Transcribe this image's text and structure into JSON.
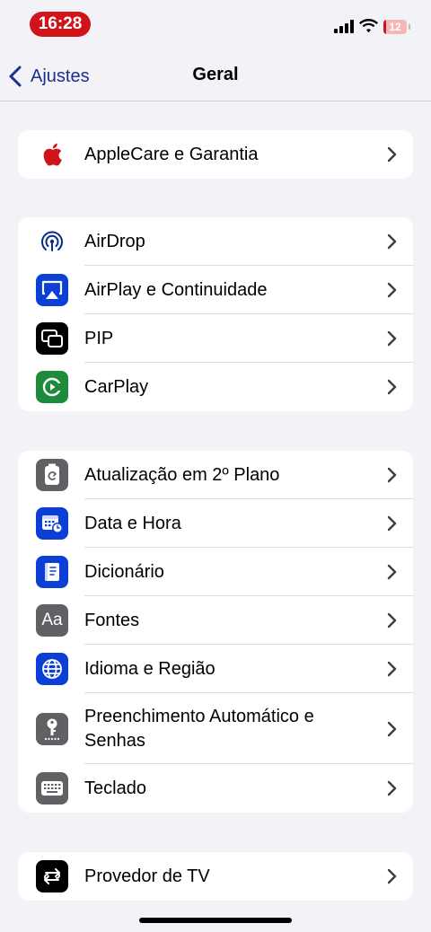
{
  "status_bar": {
    "time": "16:28",
    "battery_level": "12",
    "battery_fraction": 0.12,
    "time_pill_color": "#d0141b"
  },
  "nav": {
    "back_label": "Ajustes",
    "title": "Geral",
    "accent_color": "#1c2f8a"
  },
  "groups": [
    {
      "items": [
        {
          "label": "AppleCare e Garantia",
          "icon": "apple-logo-icon"
        }
      ]
    },
    {
      "items": [
        {
          "label": "AirDrop",
          "icon": "airdrop-icon"
        },
        {
          "label": "AirPlay e Continuidade",
          "icon": "airplay-icon"
        },
        {
          "label": "PIP",
          "icon": "picture-in-picture-icon"
        },
        {
          "label": "CarPlay",
          "icon": "carplay-icon"
        }
      ]
    },
    {
      "items": [
        {
          "label": "Atualização em 2º Plano",
          "icon": "background-refresh-icon"
        },
        {
          "label": "Data e Hora",
          "icon": "calendar-clock-icon"
        },
        {
          "label": "Dicionário",
          "icon": "dictionary-icon"
        },
        {
          "label": "Fontes",
          "icon": "fonts-icon",
          "glyph": "Aa"
        },
        {
          "label": "Idioma e Região",
          "icon": "globe-icon"
        },
        {
          "label": "Preenchimento Automático e Senhas",
          "icon": "key-icon"
        },
        {
          "label": "Teclado",
          "icon": "keyboard-icon"
        }
      ]
    },
    {
      "items": [
        {
          "label": "Provedor de TV",
          "icon": "tv-provider-icon"
        }
      ]
    }
  ]
}
